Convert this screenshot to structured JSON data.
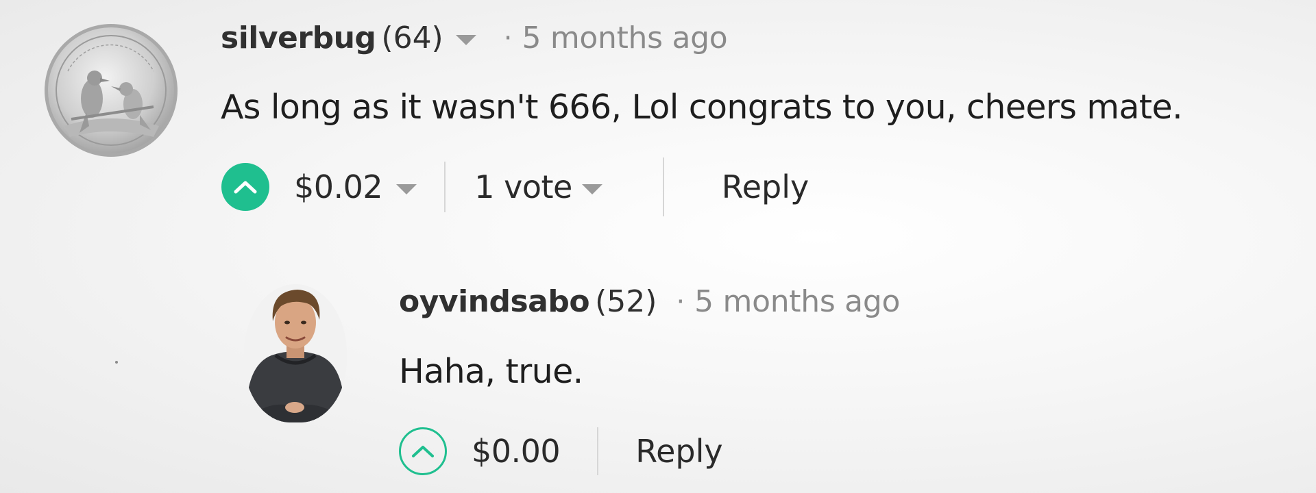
{
  "comments": [
    {
      "author": "silverbug",
      "reputation": "(64)",
      "separator": "·",
      "time": "5 months ago",
      "body": "As long as it wasn't 666, Lol congrats to you, cheers mate.",
      "payout": "$0.02",
      "votes": "1 vote",
      "reply_label": "Reply",
      "upvoted": true,
      "avatar_icon": "kookaburra-silver-coin-avatar"
    },
    {
      "author": "oyvindsabo",
      "reputation": "(52)",
      "separator": "·",
      "time": "5 months ago",
      "body": "Haha, true.",
      "payout": "$0.00",
      "reply_label": "Reply",
      "upvoted": false,
      "avatar_icon": "person-photo-avatar"
    }
  ],
  "colors": {
    "accent": "#1fbf8f",
    "author_text": "#303030",
    "muted_text": "#8a8a8a",
    "body_text": "#1e1e1e"
  }
}
